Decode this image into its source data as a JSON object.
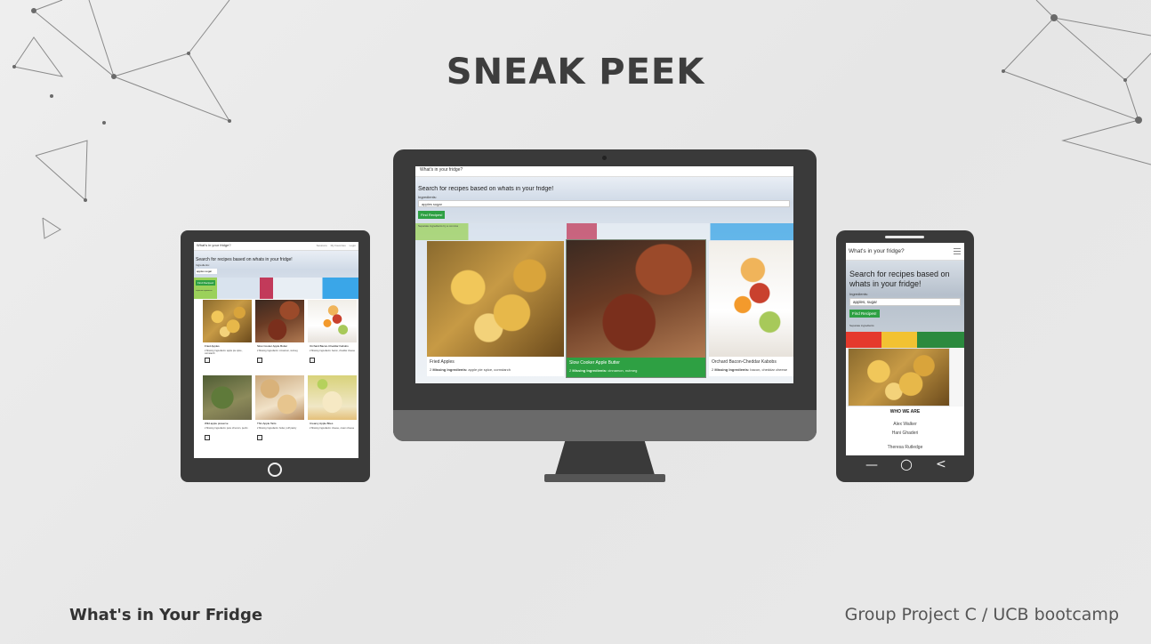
{
  "slide": {
    "title": "SNEAK PEEK",
    "footer_left": "What's in Your Fridge",
    "footer_right": "Group Project C / UCB bootcamp"
  },
  "desktop": {
    "nav_title": "What's in your fridge?",
    "heading": "Search for recipes based on whats in your fridge!",
    "ingredients_label": "Ingredients:",
    "ingredients_value": "apples sugar",
    "find_button": "Find Recipes!",
    "hint": "Separate ingredients by a comma",
    "cards": [
      {
        "title": "Fried Apples",
        "missing_label": "Missing Ingredients:",
        "missing_count": "2",
        "missing": "apple pie spice, cornstarch"
      },
      {
        "title": "Slow Cooker Apple Butter",
        "missing_label": "Missing Ingredients:",
        "missing_count": "2",
        "missing": "cinnamon, nutmeg"
      },
      {
        "title": "Orchard Bacon-Cheddar Kabobs",
        "missing_label": "Missing Ingredients:",
        "missing_count": "2",
        "missing": "bacon, cheddar cheese"
      }
    ]
  },
  "tablet": {
    "nav_title": "What's in your fridge?",
    "nav_links": [
      "Sessions",
      "My Favorites",
      "Login"
    ],
    "heading": "Search for recipes based on whats in your fridge!",
    "ingredients_label": "Ingredients:",
    "ingredients_value": "apples sugar",
    "find_button": "Find Recipes!",
    "hint": "Separate ingredients",
    "cards": [
      {
        "title": "Fried Apples",
        "missing": "2 Missing Ingredients: apple pie spice, cornstarch"
      },
      {
        "title": "Slow Cooker Apple Butter",
        "missing": "2 Missing Ingredients: cinnamon, nutmeg"
      },
      {
        "title": "Orchard Bacon-Cheddar Kabobs",
        "missing": "2 Missing Ingredients: bacon, cheddar cheese"
      },
      {
        "title": "Wild apple preserve",
        "missing": "2 Missing Ingredients: juice of lemon, pectin"
      },
      {
        "title": "Thin Apple Tarts",
        "missing": "2 Missing Ingredients: butter, puff pastry"
      },
      {
        "title": "Creamy Apple Bites",
        "missing": "2 Missing Ingredients: cheese, cream cheese"
      }
    ]
  },
  "phone": {
    "nav_title": "What's in your fridge?",
    "heading": "Search for recipes based on whats in your fridge!",
    "ingredients_label": "Ingredients:",
    "ingredients_value": "apples, sugar",
    "find_button": "Find Recipes!",
    "hint": "Separate ingredients",
    "section_title": "WHO WE ARE",
    "members": [
      "Alex Walker",
      "Hani Ghaderi",
      "Theresa Rutledge"
    ],
    "nav_buttons": {
      "back": "<",
      "home": "○",
      "recent": "—"
    }
  },
  "colors": {
    "accent_green": "#2ea043",
    "device_dark": "#3a3a3a",
    "title_text": "#3d3d3d"
  }
}
